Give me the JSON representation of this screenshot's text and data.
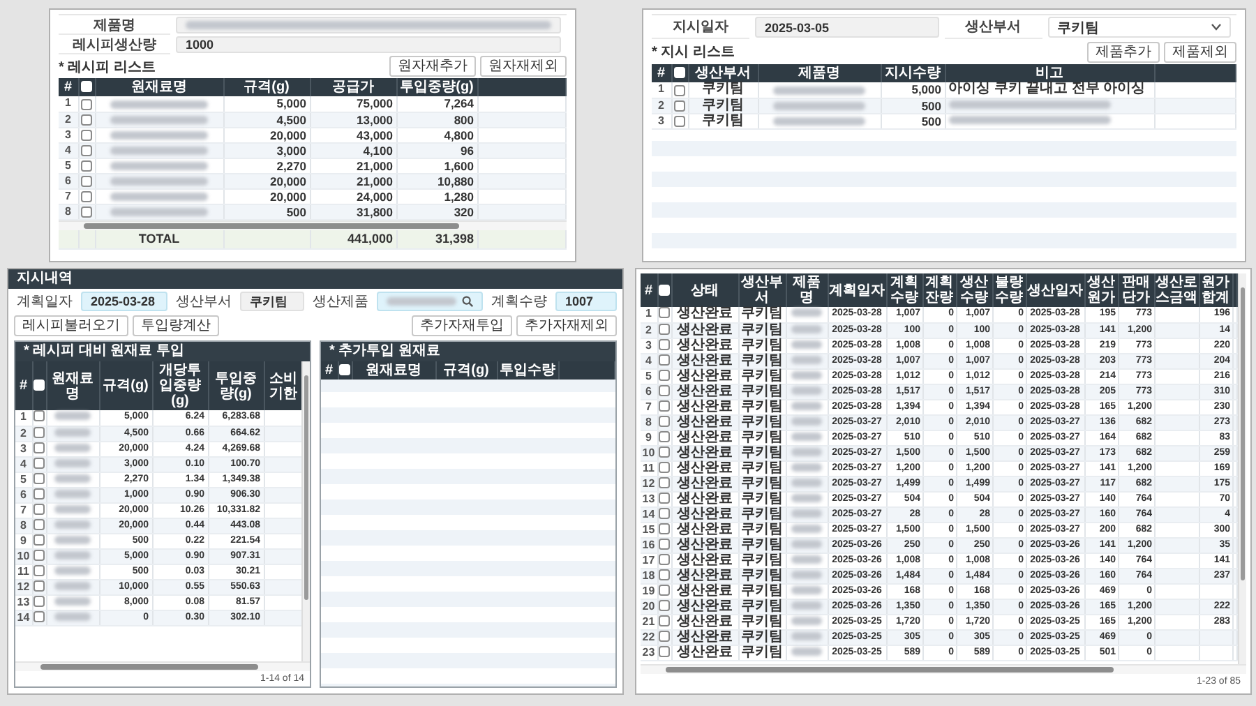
{
  "recipe": {
    "fields": [
      {
        "label": "제품명",
        "value_hidden": true
      },
      {
        "label": "레시피생산량",
        "value": "1000",
        "value_hidden": false
      }
    ],
    "list_title": "* 레시피 리스트",
    "buttons": [
      "원자재추가",
      "원자재제외"
    ],
    "grid": {
      "number_header": "#",
      "header_checked": false,
      "columns": [
        "원재료명",
        "규격(g)",
        "공급가",
        "투입중량(g)"
      ],
      "rows": [
        {
          "no": "1",
          "checked": false,
          "cells": [
            {
              "hidden": true
            },
            "5,000",
            "75,000",
            "7,264"
          ]
        },
        {
          "no": "2",
          "checked": false,
          "cells": [
            {
              "hidden": true
            },
            "4,500",
            "13,000",
            "800"
          ]
        },
        {
          "no": "3",
          "checked": false,
          "cells": [
            {
              "hidden": true
            },
            "20,000",
            "43,000",
            "4,800"
          ]
        },
        {
          "no": "4",
          "checked": false,
          "cells": [
            {
              "hidden": true
            },
            "3,000",
            "4,100",
            "96"
          ]
        },
        {
          "no": "5",
          "checked": false,
          "cells": [
            {
              "hidden": true
            },
            "2,270",
            "21,000",
            "1,600"
          ]
        },
        {
          "no": "6",
          "checked": false,
          "cells": [
            {
              "hidden": true
            },
            "20,000",
            "21,000",
            "10,880"
          ]
        },
        {
          "no": "7",
          "checked": false,
          "cells": [
            {
              "hidden": true
            },
            "20,000",
            "24,000",
            "1,280"
          ]
        },
        {
          "no": "8",
          "checked": false,
          "cells": [
            {
              "hidden": true
            },
            "500",
            "31,800",
            "320"
          ]
        }
      ],
      "total": {
        "label": "TOTAL",
        "cells": [
          "441,000",
          "31,398"
        ]
      }
    }
  },
  "order": {
    "fields": [
      {
        "label": "지시일자",
        "value": "2025-03-05",
        "kind": "text"
      },
      {
        "label": "생산부서",
        "value": "쿠키팀",
        "kind": "select"
      }
    ],
    "list_title": "* 지시 리스트",
    "buttons": [
      "제품추가",
      "제품제외"
    ],
    "grid": {
      "number_header": "#",
      "header_checked": false,
      "columns": [
        "생산부서",
        "제품명",
        "지시수량",
        "비고"
      ],
      "rows": [
        {
          "no": "1",
          "checked": false,
          "cells": [
            "쿠키팀",
            {
              "hidden": true
            },
            "5,000",
            "아이싱 쿠키 끝내고 전부 아이싱"
          ]
        },
        {
          "no": "2",
          "checked": false,
          "cells": [
            "쿠키팀",
            {
              "hidden": true
            },
            "500",
            {
              "hidden": true
            }
          ]
        },
        {
          "no": "3",
          "checked": false,
          "cells": [
            "쿠키팀",
            {
              "hidden": true
            },
            "500",
            {
              "hidden": true
            }
          ]
        }
      ]
    }
  },
  "plan": {
    "title": "지시내역",
    "fields": [
      {
        "label": "계획일자",
        "value": "2025-03-28",
        "kind": "text"
      },
      {
        "label": "생산부서",
        "value": "쿠키팀",
        "kind": "readonly"
      },
      {
        "label": "생산제품",
        "value_hidden": true,
        "kind": "search"
      },
      {
        "label": "계획수량",
        "value": "1007",
        "kind": "text"
      }
    ],
    "left_buttons": [
      "레시피불러오기",
      "투입량계산"
    ],
    "right_buttons": [
      "추가자재투입",
      "추가자재제외"
    ],
    "recipe_grid": {
      "title": "* 레시피 대비 원재료 투입",
      "number_header": "#",
      "header_checked": false,
      "columns": [
        "원재료명",
        "규격(g)",
        "개당투입중량(g)",
        "투입중량(g)",
        "소비기한"
      ],
      "rows": [
        {
          "no": "1",
          "checked": false,
          "cells": [
            {
              "hidden": true
            },
            "5,000",
            "6.24",
            "6,283.68",
            null
          ]
        },
        {
          "no": "2",
          "checked": false,
          "cells": [
            {
              "hidden": true
            },
            "4,500",
            "0.66",
            "664.62",
            null
          ]
        },
        {
          "no": "3",
          "checked": false,
          "cells": [
            {
              "hidden": true
            },
            "20,000",
            "4.24",
            "4,269.68",
            null
          ]
        },
        {
          "no": "4",
          "checked": false,
          "cells": [
            {
              "hidden": true
            },
            "3,000",
            "0.10",
            "100.70",
            null
          ]
        },
        {
          "no": "5",
          "checked": false,
          "cells": [
            {
              "hidden": true
            },
            "2,270",
            "1.34",
            "1,349.38",
            null
          ]
        },
        {
          "no": "6",
          "checked": false,
          "cells": [
            {
              "hidden": true
            },
            "1,000",
            "0.90",
            "906.30",
            null
          ]
        },
        {
          "no": "7",
          "checked": false,
          "cells": [
            {
              "hidden": true
            },
            "20,000",
            "10.26",
            "10,331.82",
            null
          ]
        },
        {
          "no": "8",
          "checked": false,
          "cells": [
            {
              "hidden": true
            },
            "20,000",
            "0.44",
            "443.08",
            null
          ]
        },
        {
          "no": "9",
          "checked": false,
          "cells": [
            {
              "hidden": true
            },
            "500",
            "0.22",
            "221.54",
            null
          ]
        },
        {
          "no": "10",
          "checked": false,
          "cells": [
            {
              "hidden": true
            },
            "5,000",
            "0.90",
            "907.31",
            null
          ]
        },
        {
          "no": "11",
          "checked": false,
          "cells": [
            {
              "hidden": true
            },
            "500",
            "0.03",
            "30.21",
            null
          ]
        },
        {
          "no": "12",
          "checked": false,
          "cells": [
            {
              "hidden": true
            },
            "10,000",
            "0.55",
            "550.63",
            null
          ]
        },
        {
          "no": "13",
          "checked": false,
          "cells": [
            {
              "hidden": true
            },
            "8,000",
            "0.08",
            "81.57",
            null
          ]
        },
        {
          "no": "14",
          "checked": false,
          "cells": [
            {
              "hidden": true
            },
            "0",
            "0.30",
            "302.10",
            null
          ]
        }
      ],
      "pager": "1-14 of 14"
    },
    "extra_grid": {
      "title": "* 추가투입 원재료",
      "number_header": "#",
      "header_checked": false,
      "columns": [
        "원재료명",
        "규격(g)",
        "투입수량"
      ]
    }
  },
  "results": {
    "grid": {
      "number_header": "#",
      "header_checked": false,
      "columns": [
        "상태",
        "생산부서",
        "제품명",
        "계획일자",
        "계획수량",
        "계획잔량",
        "생산수량",
        "불량수량",
        "생산일자",
        "생산원가",
        "판매단가",
        "생산로스금액",
        "원가합계"
      ],
      "rows": [
        {
          "no": "1",
          "checked": false,
          "cells": [
            "생산완료",
            "쿠키팀",
            {
              "hidden": true
            },
            "2025-03-28",
            "1,007",
            "0",
            "1,007",
            "0",
            "2025-03-28",
            "195",
            "773",
            null,
            "196"
          ]
        },
        {
          "no": "2",
          "checked": false,
          "cells": [
            "생산완료",
            "쿠키팀",
            {
              "hidden": true
            },
            "2025-03-28",
            "100",
            "0",
            "100",
            "0",
            "2025-03-28",
            "141",
            "1,200",
            null,
            "14"
          ]
        },
        {
          "no": "3",
          "checked": false,
          "cells": [
            "생산완료",
            "쿠키팀",
            {
              "hidden": true
            },
            "2025-03-28",
            "1,008",
            "0",
            "1,008",
            "0",
            "2025-03-28",
            "219",
            "773",
            null,
            "220"
          ]
        },
        {
          "no": "4",
          "checked": false,
          "cells": [
            "생산완료",
            "쿠키팀",
            {
              "hidden": true
            },
            "2025-03-28",
            "1,007",
            "0",
            "1,007",
            "0",
            "2025-03-28",
            "203",
            "773",
            null,
            "204"
          ]
        },
        {
          "no": "5",
          "checked": false,
          "cells": [
            "생산완료",
            "쿠키팀",
            {
              "hidden": true
            },
            "2025-03-28",
            "1,012",
            "0",
            "1,012",
            "0",
            "2025-03-28",
            "214",
            "773",
            null,
            "216"
          ]
        },
        {
          "no": "6",
          "checked": false,
          "cells": [
            "생산완료",
            "쿠키팀",
            {
              "hidden": true
            },
            "2025-03-28",
            "1,517",
            "0",
            "1,517",
            "0",
            "2025-03-28",
            "205",
            "773",
            null,
            "310"
          ]
        },
        {
          "no": "7",
          "checked": false,
          "cells": [
            "생산완료",
            "쿠키팀",
            {
              "hidden": true
            },
            "2025-03-28",
            "1,394",
            "0",
            "1,394",
            "0",
            "2025-03-28",
            "165",
            "1,200",
            null,
            "230"
          ]
        },
        {
          "no": "8",
          "checked": false,
          "cells": [
            "생산완료",
            "쿠키팀",
            {
              "hidden": true
            },
            "2025-03-27",
            "2,010",
            "0",
            "2,010",
            "0",
            "2025-03-27",
            "136",
            "682",
            null,
            "273"
          ]
        },
        {
          "no": "9",
          "checked": false,
          "cells": [
            "생산완료",
            "쿠키팀",
            {
              "hidden": true
            },
            "2025-03-27",
            "510",
            "0",
            "510",
            "0",
            "2025-03-27",
            "164",
            "682",
            null,
            "83"
          ]
        },
        {
          "no": "10",
          "checked": false,
          "cells": [
            "생산완료",
            "쿠키팀",
            {
              "hidden": true
            },
            "2025-03-27",
            "1,500",
            "0",
            "1,500",
            "0",
            "2025-03-27",
            "173",
            "682",
            null,
            "259"
          ]
        },
        {
          "no": "11",
          "checked": false,
          "cells": [
            "생산완료",
            "쿠키팀",
            {
              "hidden": true
            },
            "2025-03-27",
            "1,200",
            "0",
            "1,200",
            "0",
            "2025-03-27",
            "141",
            "1,200",
            null,
            "169"
          ]
        },
        {
          "no": "12",
          "checked": false,
          "cells": [
            "생산완료",
            "쿠키팀",
            {
              "hidden": true
            },
            "2025-03-27",
            "1,499",
            "0",
            "1,499",
            "0",
            "2025-03-27",
            "117",
            "682",
            null,
            "175"
          ]
        },
        {
          "no": "13",
          "checked": false,
          "cells": [
            "생산완료",
            "쿠키팀",
            {
              "hidden": true
            },
            "2025-03-27",
            "504",
            "0",
            "504",
            "0",
            "2025-03-27",
            "140",
            "764",
            null,
            "70"
          ]
        },
        {
          "no": "14",
          "checked": false,
          "cells": [
            "생산완료",
            "쿠키팀",
            {
              "hidden": true
            },
            "2025-03-27",
            "28",
            "0",
            "28",
            "0",
            "2025-03-27",
            "160",
            "764",
            null,
            "4"
          ]
        },
        {
          "no": "15",
          "checked": false,
          "cells": [
            "생산완료",
            "쿠키팀",
            {
              "hidden": true
            },
            "2025-03-27",
            "1,500",
            "0",
            "1,500",
            "0",
            "2025-03-27",
            "200",
            "682",
            null,
            "300"
          ]
        },
        {
          "no": "16",
          "checked": false,
          "cells": [
            "생산완료",
            "쿠키팀",
            {
              "hidden": true
            },
            "2025-03-26",
            "250",
            "0",
            "250",
            "0",
            "2025-03-26",
            "141",
            "1,200",
            null,
            "35"
          ]
        },
        {
          "no": "17",
          "checked": false,
          "cells": [
            "생산완료",
            "쿠키팀",
            {
              "hidden": true
            },
            "2025-03-26",
            "1,008",
            "0",
            "1,008",
            "0",
            "2025-03-26",
            "140",
            "764",
            null,
            "141"
          ]
        },
        {
          "no": "18",
          "checked": false,
          "cells": [
            "생산완료",
            "쿠키팀",
            {
              "hidden": true
            },
            "2025-03-26",
            "1,484",
            "0",
            "1,484",
            "0",
            "2025-03-26",
            "160",
            "764",
            null,
            "237"
          ]
        },
        {
          "no": "19",
          "checked": false,
          "cells": [
            "생산완료",
            "쿠키팀",
            {
              "hidden": true
            },
            "2025-03-26",
            "168",
            "0",
            "168",
            "0",
            "2025-03-26",
            "469",
            "0",
            null,
            null
          ]
        },
        {
          "no": "20",
          "checked": false,
          "cells": [
            "생산완료",
            "쿠키팀",
            {
              "hidden": true
            },
            "2025-03-26",
            "1,350",
            "0",
            "1,350",
            "0",
            "2025-03-26",
            "165",
            "1,200",
            null,
            "222"
          ]
        },
        {
          "no": "21",
          "checked": false,
          "cells": [
            "생산완료",
            "쿠키팀",
            {
              "hidden": true
            },
            "2025-03-25",
            "1,720",
            "0",
            "1,720",
            "0",
            "2025-03-25",
            "165",
            "1,200",
            null,
            "283"
          ]
        },
        {
          "no": "22",
          "checked": false,
          "cells": [
            "생산완료",
            "쿠키팀",
            {
              "hidden": true
            },
            "2025-03-25",
            "305",
            "0",
            "305",
            "0",
            "2025-03-25",
            "469",
            "0",
            null,
            null
          ]
        },
        {
          "no": "23",
          "checked": false,
          "cells": [
            "생산완료",
            "쿠키팀",
            {
              "hidden": true
            },
            "2025-03-25",
            "589",
            "0",
            "589",
            "0",
            "2025-03-25",
            "501",
            "0",
            null,
            null
          ]
        }
      ],
      "pager": "1-23 of 85"
    }
  }
}
